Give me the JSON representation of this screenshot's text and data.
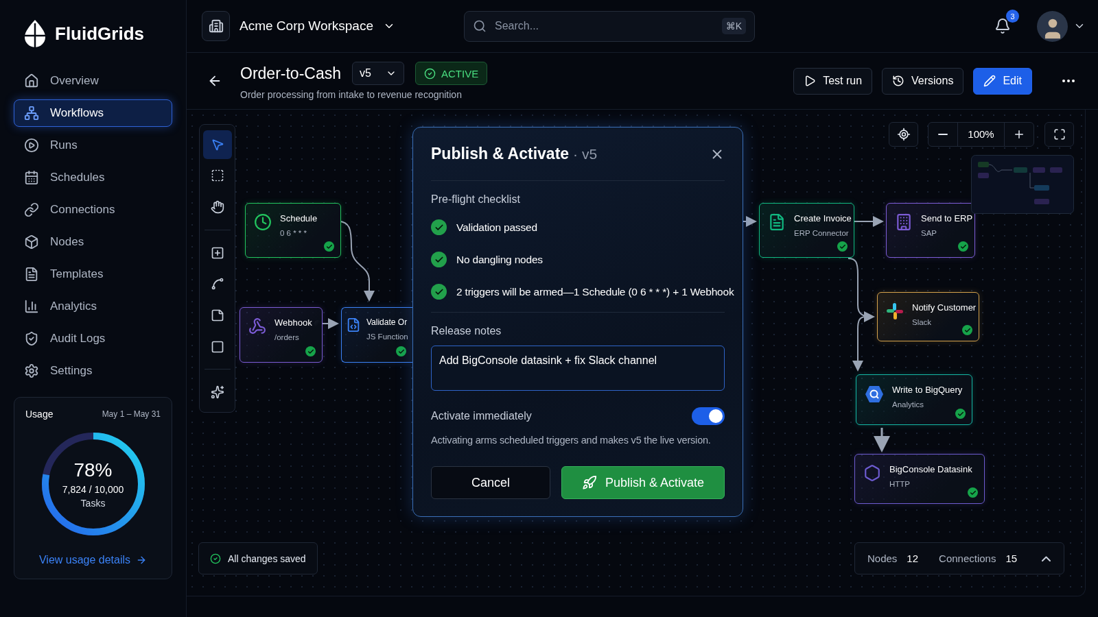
{
  "brand": {
    "name": "FluidGrids"
  },
  "sidebar": {
    "items": [
      {
        "label": "Overview",
        "selected": false
      },
      {
        "label": "Workflows",
        "selected": true
      },
      {
        "label": "Runs",
        "selected": false
      },
      {
        "label": "Schedules",
        "selected": false
      },
      {
        "label": "Connections",
        "selected": false
      },
      {
        "label": "Nodes",
        "selected": false
      },
      {
        "label": "Templates",
        "selected": false
      },
      {
        "label": "Analytics",
        "selected": false
      },
      {
        "label": "Audit Logs",
        "selected": false
      },
      {
        "label": "Settings",
        "selected": false
      }
    ]
  },
  "usage": {
    "title": "Usage",
    "period": "May 1 – May 31",
    "percent": "78%",
    "count": "7,824 / 10,000",
    "unit": "Tasks",
    "level": 0.78,
    "link": "View usage details"
  },
  "topbar": {
    "workspace": "Acme Corp Workspace",
    "search": {
      "placeholder": "Search...",
      "shortcut": "⌘K"
    },
    "notifications": "3"
  },
  "workflow": {
    "title": "Order-to-Cash",
    "version": "v5",
    "status": "ACTIVE",
    "subtitle": "Order processing from intake to revenue recognition",
    "actions": [
      {
        "label": "Test run",
        "kind": "test"
      },
      {
        "label": "Versions",
        "kind": "versions"
      },
      {
        "label": "Edit",
        "kind": "edit"
      }
    ]
  },
  "tools": [
    {
      "kind": "pointer",
      "selected": true
    },
    {
      "kind": "marquee",
      "selected": false
    },
    {
      "kind": "hand",
      "selected": false
    },
    {
      "kind": "add",
      "selected": false
    },
    {
      "kind": "connect",
      "selected": false
    },
    {
      "kind": "note",
      "selected": false
    },
    {
      "kind": "frame",
      "selected": false
    },
    {
      "kind": "magic",
      "selected": false
    }
  ],
  "zoom": {
    "value": "100%"
  },
  "nodes": [
    {
      "title": "Schedule",
      "subtitle": "0 6 * * *",
      "kind": "schedule",
      "color": "#22c55e"
    },
    {
      "title": "Webhook",
      "subtitle": "/orders",
      "kind": "webhook",
      "color": "#7c5cd6"
    },
    {
      "title": "Validate Or",
      "subtitle": "JS Function",
      "kind": "function",
      "color": "#3b82f6"
    },
    {
      "title": "Create Invoice",
      "subtitle": "ERP Connector",
      "kind": "document",
      "color": "#10b981"
    },
    {
      "title": "Send to ERP",
      "subtitle": "SAP",
      "kind": "building",
      "color": "#7c5cd6"
    },
    {
      "title": "Notify Customer",
      "subtitle": "Slack",
      "kind": "slack",
      "color": "#d4a24c"
    },
    {
      "title": "Write to BigQuery",
      "subtitle": "Analytics",
      "kind": "bigquery",
      "color": "#14b8a6"
    },
    {
      "title": "BigConsole Datasink",
      "subtitle": "HTTP",
      "kind": "datasink",
      "color": "#6d5bd0"
    }
  ],
  "dialog": {
    "title": "Publish & Activate",
    "version": "· v5",
    "checklist_title": "Pre-flight checklist",
    "checklist": [
      {
        "label": "Validation passed",
        "passed": true
      },
      {
        "label": "No dangling nodes",
        "passed": true
      },
      {
        "label": "2 triggers will be armed—1 Schedule (0 6 * * *) + 1 Webhook",
        "passed": true
      }
    ],
    "notes_label": "Release notes",
    "notes": "Add BigConsole datasink + fix Slack channel",
    "activate": {
      "label": "Activate immediately",
      "on": true
    },
    "help": "Activating arms scheduled triggers and makes v5 the live version.",
    "cancel": "Cancel",
    "confirm": "Publish & Activate"
  },
  "status_bar": {
    "saved": "All changes saved",
    "stats": [
      {
        "label": "Nodes",
        "value": "12"
      },
      {
        "label": "Connections",
        "value": "15"
      }
    ]
  }
}
